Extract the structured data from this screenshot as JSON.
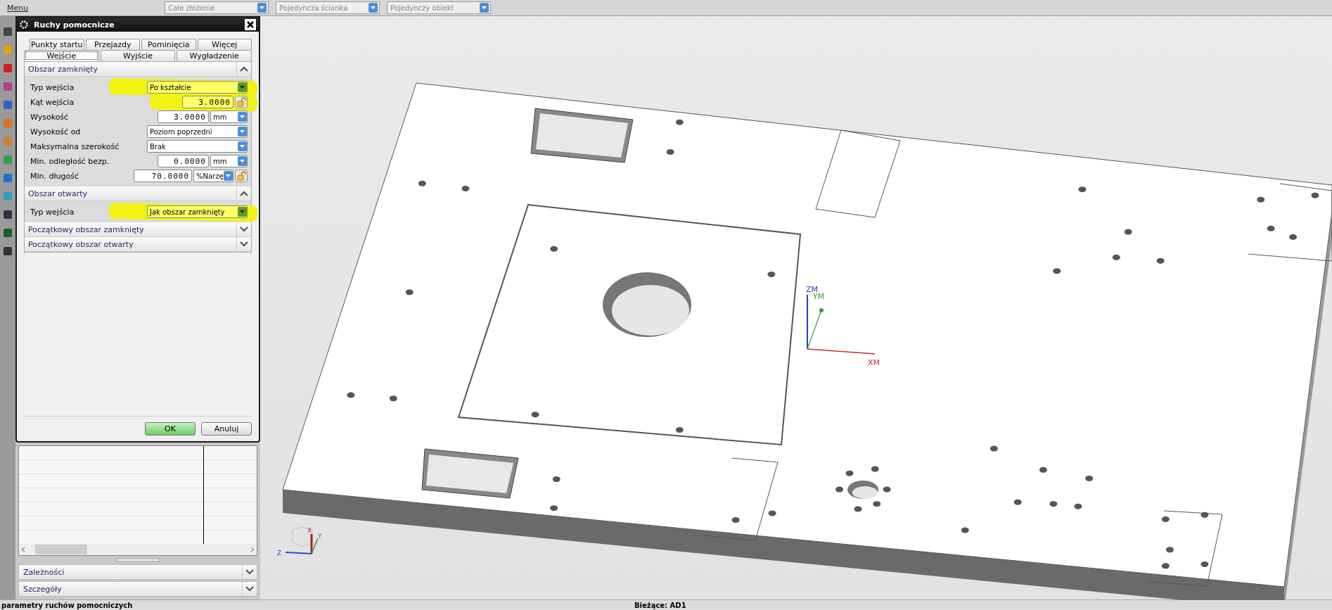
{
  "menu": {
    "label": "Menu"
  },
  "toolbar": {
    "dropdowns": [
      "Całe złożenie",
      "Pojedyncza ścianka",
      "Pojedynczy obiekt"
    ]
  },
  "dialog": {
    "title": "Ruchy pomocnicze",
    "tab_rows": [
      {
        "tabs": [
          {
            "label": "Punkty startu",
            "selected": false
          },
          {
            "label": "Przejazdy",
            "selected": false
          },
          {
            "label": "Pominięcia",
            "selected": false
          },
          {
            "label": "Więcej",
            "selected": false
          }
        ]
      },
      {
        "tabs": [
          {
            "label": "Wejście",
            "selected": true
          },
          {
            "label": "Wyjście",
            "selected": false
          },
          {
            "label": "Wygładzenie",
            "selected": false
          }
        ]
      }
    ],
    "groups": [
      {
        "title": "Obszar zamknięty",
        "expanded": true,
        "rows": [
          {
            "label": "Typ wejścia",
            "kind": "dropdown",
            "value": "Po kształcie",
            "highlighted": true
          },
          {
            "label": "Kąt wejścia",
            "kind": "number",
            "value": "3.0000",
            "lock": true,
            "highlighted": true
          },
          {
            "label": "Wysokość",
            "kind": "number",
            "value": "3.0000",
            "unit": "mm",
            "lock": false,
            "highlighted": false
          },
          {
            "label": "Wysokość od",
            "kind": "dropdown",
            "value": "Poziom poprzedni",
            "highlighted": false
          },
          {
            "label": "Maksymalna szerokość",
            "kind": "dropdown",
            "value": "Brak",
            "highlighted": false
          },
          {
            "label": "Min. odległość bezp.",
            "kind": "number",
            "value": "0.0000",
            "unit": "mm",
            "lock": false,
            "highlighted": false
          },
          {
            "label": "Min. długość",
            "kind": "number",
            "value": "70.0000",
            "unit": "%Narzę",
            "lock": true,
            "highlighted": false
          }
        ]
      },
      {
        "title": "Obszar otwarty",
        "expanded": true,
        "rows": [
          {
            "label": "Typ wejścia",
            "kind": "dropdown",
            "value": "Jak obszar zamknięty",
            "highlighted": true
          }
        ]
      },
      {
        "title": "Początkowy obszar zamknięty",
        "expanded": false
      },
      {
        "title": "Początkowy obszar otwarty",
        "expanded": false
      }
    ],
    "buttons": [
      {
        "label": "OK",
        "kind": "default"
      },
      {
        "label": "Anuluj",
        "kind": "normal"
      }
    ]
  },
  "navigator": {
    "sections": [
      {
        "title": "Zależności",
        "expanded": false
      },
      {
        "title": "Szczegóły",
        "expanded": false
      }
    ]
  },
  "viewport": {
    "triad": {
      "x": "XM",
      "y": "YM",
      "z": "ZM"
    },
    "mini_triad": {
      "x": "X",
      "y": "Y",
      "z": "Z"
    }
  },
  "status_bar": {
    "message": "parametry ruchów pomocniczych",
    "current": "Bieżące: AD1"
  }
}
